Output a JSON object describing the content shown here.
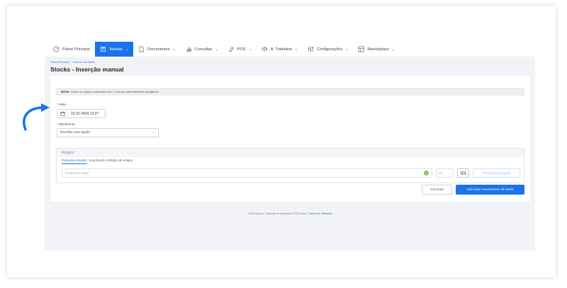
{
  "nav": {
    "items": [
      {
        "label": "Painel Principal",
        "icon": "dashboard-icon",
        "active": false,
        "dropdown": false
      },
      {
        "label": "Tabelas",
        "icon": "tables-icon",
        "active": true,
        "dropdown": true
      },
      {
        "label": "Documentos",
        "icon": "document-icon",
        "active": false,
        "dropdown": true
      },
      {
        "label": "Consultas",
        "icon": "chart-icon",
        "active": false,
        "dropdown": true
      },
      {
        "label": "POS",
        "icon": "pos-icon",
        "active": false,
        "dropdown": true
      },
      {
        "label": "A. Tributária",
        "icon": "balance-icon",
        "active": false,
        "dropdown": true
      },
      {
        "label": "Configurações",
        "icon": "settings-icon",
        "active": false,
        "dropdown": true
      },
      {
        "label": "Marketplace",
        "icon": "marketplace-icon",
        "active": false,
        "dropdown": true
      }
    ]
  },
  "breadcrumb": {
    "home": "Painel Principal",
    "current": "Controlo de stocks"
  },
  "page": {
    "title": "Stocks - Inserção manual"
  },
  "note": {
    "bold": "NOTA:",
    "text_before": "Todos os campos marcados com",
    "marker": "(*)",
    "text_after": "são de preenchimento obrigatório."
  },
  "form": {
    "required_marker": "*",
    "date_label": "Data",
    "date_value": "15-01-2024 12:27",
    "movement_label": "Movimento",
    "movement_placeholder": "Escolha uma opção"
  },
  "artigos": {
    "title": "Artigos",
    "tabs": [
      "Pesquisa simples",
      "Importação múltipla de artigos"
    ],
    "search_placeholder": "Pesquisar artigo",
    "badge": "0",
    "qty_value": "10",
    "advanced_label": "Pesquisa avançada"
  },
  "actions": {
    "cancel": "Cancelar",
    "add": "Adicionar movimentos de stock"
  },
  "footer": {
    "text": "©2024 Moloni - Software de faturação e POS online |",
    "link": "Termos de Utilização"
  },
  "colors": {
    "primary": "#1a73e8",
    "required": "#e53935",
    "annotation_arrow": "#1a73e8"
  }
}
